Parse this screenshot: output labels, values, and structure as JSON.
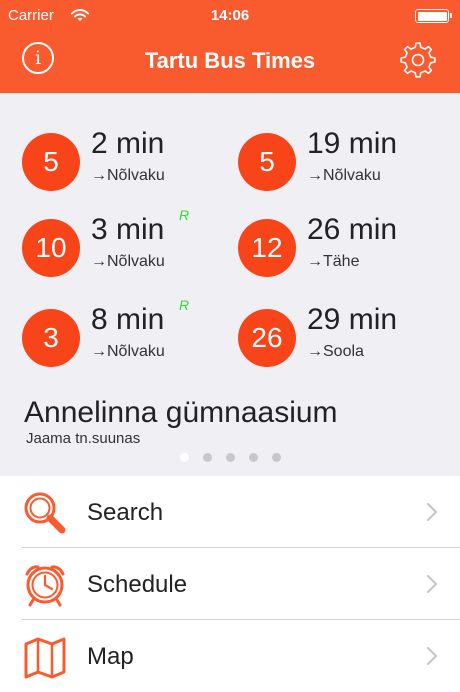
{
  "status_bar": {
    "carrier": "Carrier",
    "time": "14:06"
  },
  "header": {
    "title": "Tartu Bus Times"
  },
  "departures": [
    {
      "route": "5",
      "minutes": "2 min",
      "destination": "→Nõlvaku",
      "realtime": ""
    },
    {
      "route": "5",
      "minutes": "19 min",
      "destination": "→Nõlvaku",
      "realtime": ""
    },
    {
      "route": "10",
      "minutes": "3 min",
      "destination": "→Nõlvaku",
      "realtime": "R"
    },
    {
      "route": "12",
      "minutes": "26 min",
      "destination": "→Tähe",
      "realtime": ""
    },
    {
      "route": "3",
      "minutes": "8 min",
      "destination": "→Nõlvaku",
      "realtime": "R"
    },
    {
      "route": "26",
      "minutes": "29 min",
      "destination": "→Soola",
      "realtime": ""
    }
  ],
  "stop": {
    "name": "Annelinna gümnaasium",
    "direction": "Jaama tn.suunas"
  },
  "pager": {
    "count": 5,
    "active_index": 0
  },
  "menu": [
    {
      "label": "Search",
      "icon": "search-icon"
    },
    {
      "label": "Schedule",
      "icon": "alarm-clock-icon"
    },
    {
      "label": "Map",
      "icon": "map-icon"
    }
  ],
  "colors": {
    "accent": "#f95b2e",
    "badge": "#f74418",
    "realtime": "#33dd33",
    "panel_bg": "#efeff4"
  }
}
